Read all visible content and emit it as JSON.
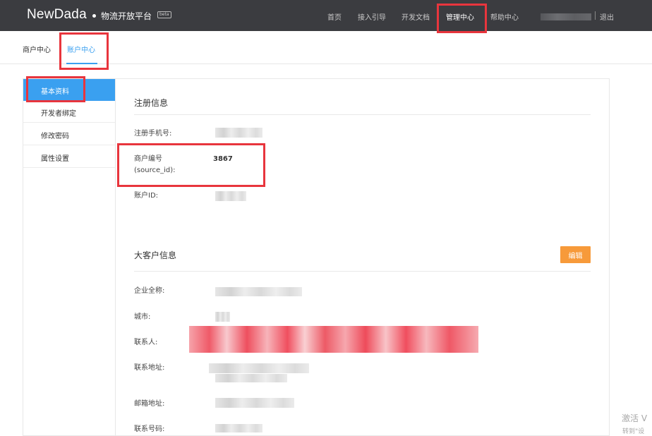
{
  "header": {
    "logo": "NewDada",
    "platform_name": "物流开放平台",
    "badge": "beta",
    "nav": [
      {
        "label": "首页"
      },
      {
        "label": "接入引导"
      },
      {
        "label": "开发文档"
      },
      {
        "label": "管理中心"
      },
      {
        "label": "帮助中心"
      }
    ],
    "logout": "退出"
  },
  "subnav": {
    "tabs": [
      {
        "label": "商户中心"
      },
      {
        "label": "账户中心"
      }
    ]
  },
  "sidebar": {
    "items": [
      {
        "label": "基本资料"
      },
      {
        "label": "开发者绑定"
      },
      {
        "label": "修改密码"
      },
      {
        "label": "属性设置"
      }
    ]
  },
  "registration": {
    "title": "注册信息",
    "phone_label": "注册手机号:",
    "merchant_no_label_1": "商户编号",
    "merchant_no_label_2": "(source_id):",
    "merchant_no_value": "3867",
    "account_id_label": "账户ID:"
  },
  "enterprise": {
    "title": "大客户信息",
    "edit_label": "编辑",
    "company_label": "企业全称:",
    "city_label": "城市:",
    "contact_label": "联系人:",
    "address_label": "联系地址:",
    "mail_address_label": "邮箱地址:",
    "phone_label": "联系号码:"
  },
  "watermark": {
    "line1": "激活 V",
    "line2": "转到\"设"
  },
  "colors": {
    "topbar": "#3b3c40",
    "accent": "#3aa0f0",
    "edit_button": "#f79a3a",
    "annotation": "#e8353d"
  }
}
